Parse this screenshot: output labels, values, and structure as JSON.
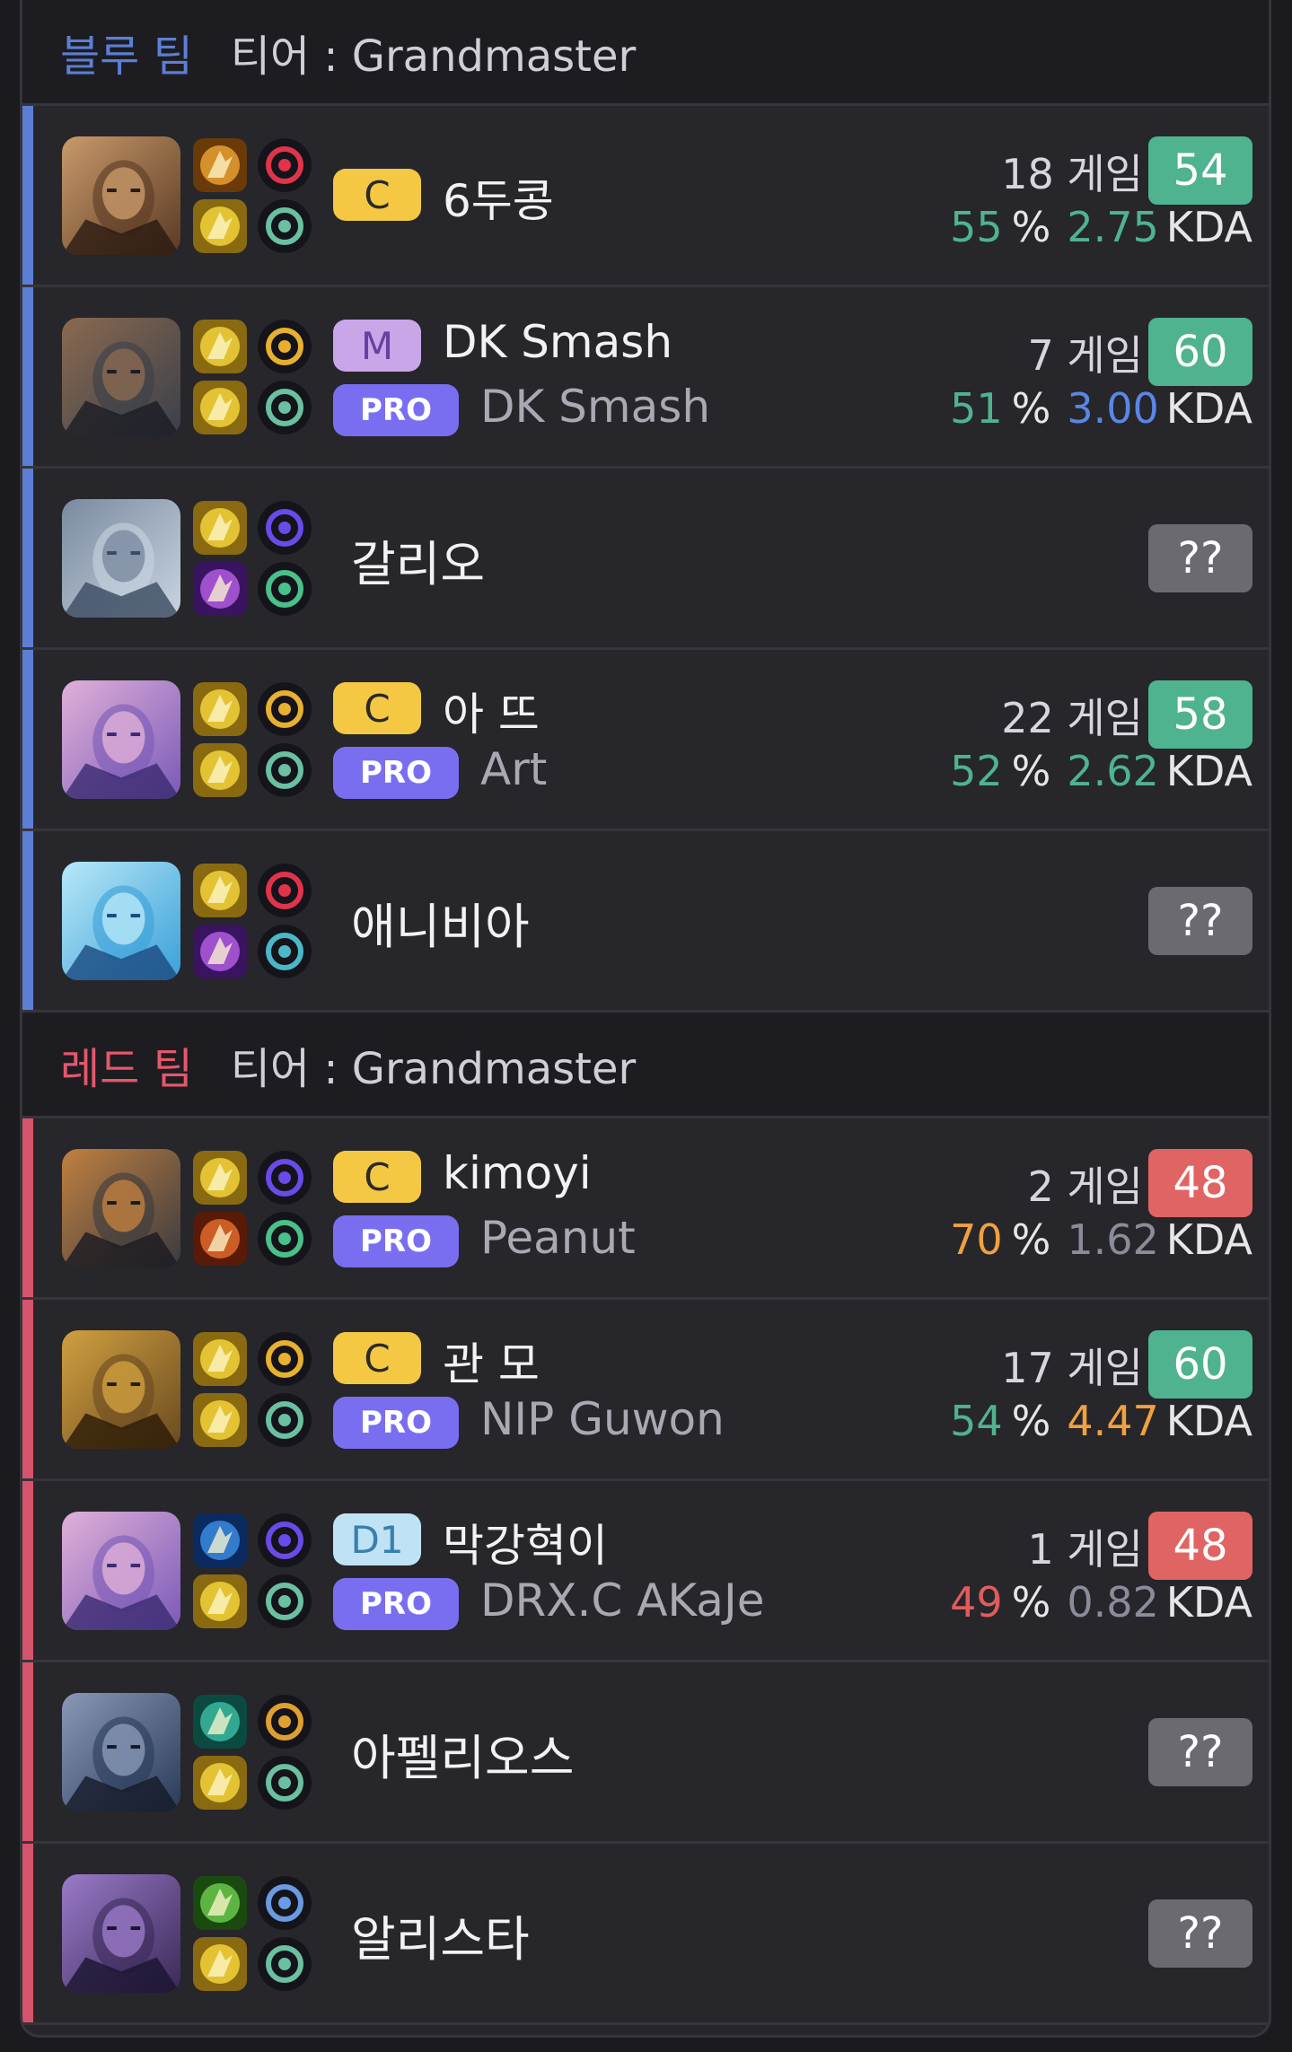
{
  "teams": {
    "blue": {
      "name": "블루 팀",
      "tier_label": "티어 : Grandmaster",
      "players": [
        {
          "champion": "Jayce",
          "rank": "C",
          "rank_bg": "#f4c842",
          "rank_fg": "#2a2a2a",
          "name": "6두콩",
          "pro": null,
          "pro_name": null,
          "games": "18 게임",
          "score": "54",
          "score_color": "green",
          "winrate": "55",
          "winrate_color": "green",
          "kda": "2.75",
          "kda_color": "green"
        },
        {
          "champion": "Zeri",
          "rank": "M",
          "rank_bg": "#c9a6e8",
          "rank_fg": "#6a3fa0",
          "name": "DK Smash",
          "pro": "PRO",
          "pro_name": "DK Smash",
          "games": "7 게임",
          "score": "60",
          "score_color": "green",
          "winrate": "51",
          "winrate_color": "green",
          "kda": "3.00",
          "kda_color": "blue"
        },
        {
          "champion": "Galio",
          "rank": null,
          "name": "갈리오",
          "pro": null,
          "pro_name": null,
          "games": null,
          "score": "??",
          "score_color": "unk",
          "winrate": null,
          "kda": null
        },
        {
          "champion": "Lillia",
          "rank": "C",
          "rank_bg": "#f4c842",
          "rank_fg": "#2a2a2a",
          "name": "아 뜨",
          "pro": "PRO",
          "pro_name": "Art",
          "games": "22 게임",
          "score": "58",
          "score_color": "green",
          "winrate": "52",
          "winrate_color": "green",
          "kda": "2.62",
          "kda_color": "green"
        },
        {
          "champion": "Anivia",
          "rank": null,
          "name": "애니비아",
          "pro": null,
          "pro_name": null,
          "games": null,
          "score": "??",
          "score_color": "unk",
          "winrate": null,
          "kda": null
        }
      ]
    },
    "red": {
      "name": "레드 팀",
      "tier_label": "티어 : Grandmaster",
      "players": [
        {
          "champion": "Rengar",
          "rank": "C",
          "rank_bg": "#f4c842",
          "rank_fg": "#2a2a2a",
          "name": "kimoyi",
          "pro": "PRO",
          "pro_name": "Peanut",
          "games": "2 게임",
          "score": "48",
          "score_color": "red",
          "winrate": "70",
          "winrate_color": "orange",
          "kda": "1.62",
          "kda_color": "gray"
        },
        {
          "champion": "Pantheon",
          "rank": "C",
          "rank_bg": "#f4c842",
          "rank_fg": "#2a2a2a",
          "name": "관 모",
          "pro": "PRO",
          "pro_name": "NIP Guwon",
          "games": "17 게임",
          "score": "60",
          "score_color": "green",
          "winrate": "54",
          "winrate_color": "green",
          "kda": "4.47",
          "kda_color": "orange"
        },
        {
          "champion": "Lillia",
          "rank": "D1",
          "rank_bg": "#bfe3f5",
          "rank_fg": "#3a7fae",
          "name": "막강혁이",
          "pro": "PRO",
          "pro_name": "DRX.C AKaJe",
          "games": "1 게임",
          "score": "48",
          "score_color": "red",
          "winrate": "49",
          "winrate_color": "red",
          "kda": "0.82",
          "kda_color": "gray"
        },
        {
          "champion": "Aphelios",
          "rank": null,
          "name": "아펠리오스",
          "pro": null,
          "pro_name": null,
          "games": null,
          "score": "??",
          "score_color": "unk",
          "winrate": null,
          "kda": null
        },
        {
          "champion": "Alistar",
          "rank": null,
          "name": "알리스타",
          "pro": null,
          "pro_name": null,
          "games": null,
          "score": "??",
          "score_color": "unk",
          "winrate": null,
          "kda": null
        }
      ]
    }
  },
  "labels": {
    "percent": "%",
    "kda": "KDA"
  },
  "icons": {
    "spells": [
      "flash-icon",
      "smite-icon",
      "teleport-icon",
      "ghost-icon",
      "cleanse-icon",
      "ignite-icon"
    ],
    "runes": [
      "electrocute-icon",
      "conqueror-icon",
      "dark-harvest-icon",
      "arcane-comet-icon",
      "phase-rush-icon",
      "grasp-icon",
      "lethal-tempo-icon",
      "aery-icon"
    ]
  }
}
